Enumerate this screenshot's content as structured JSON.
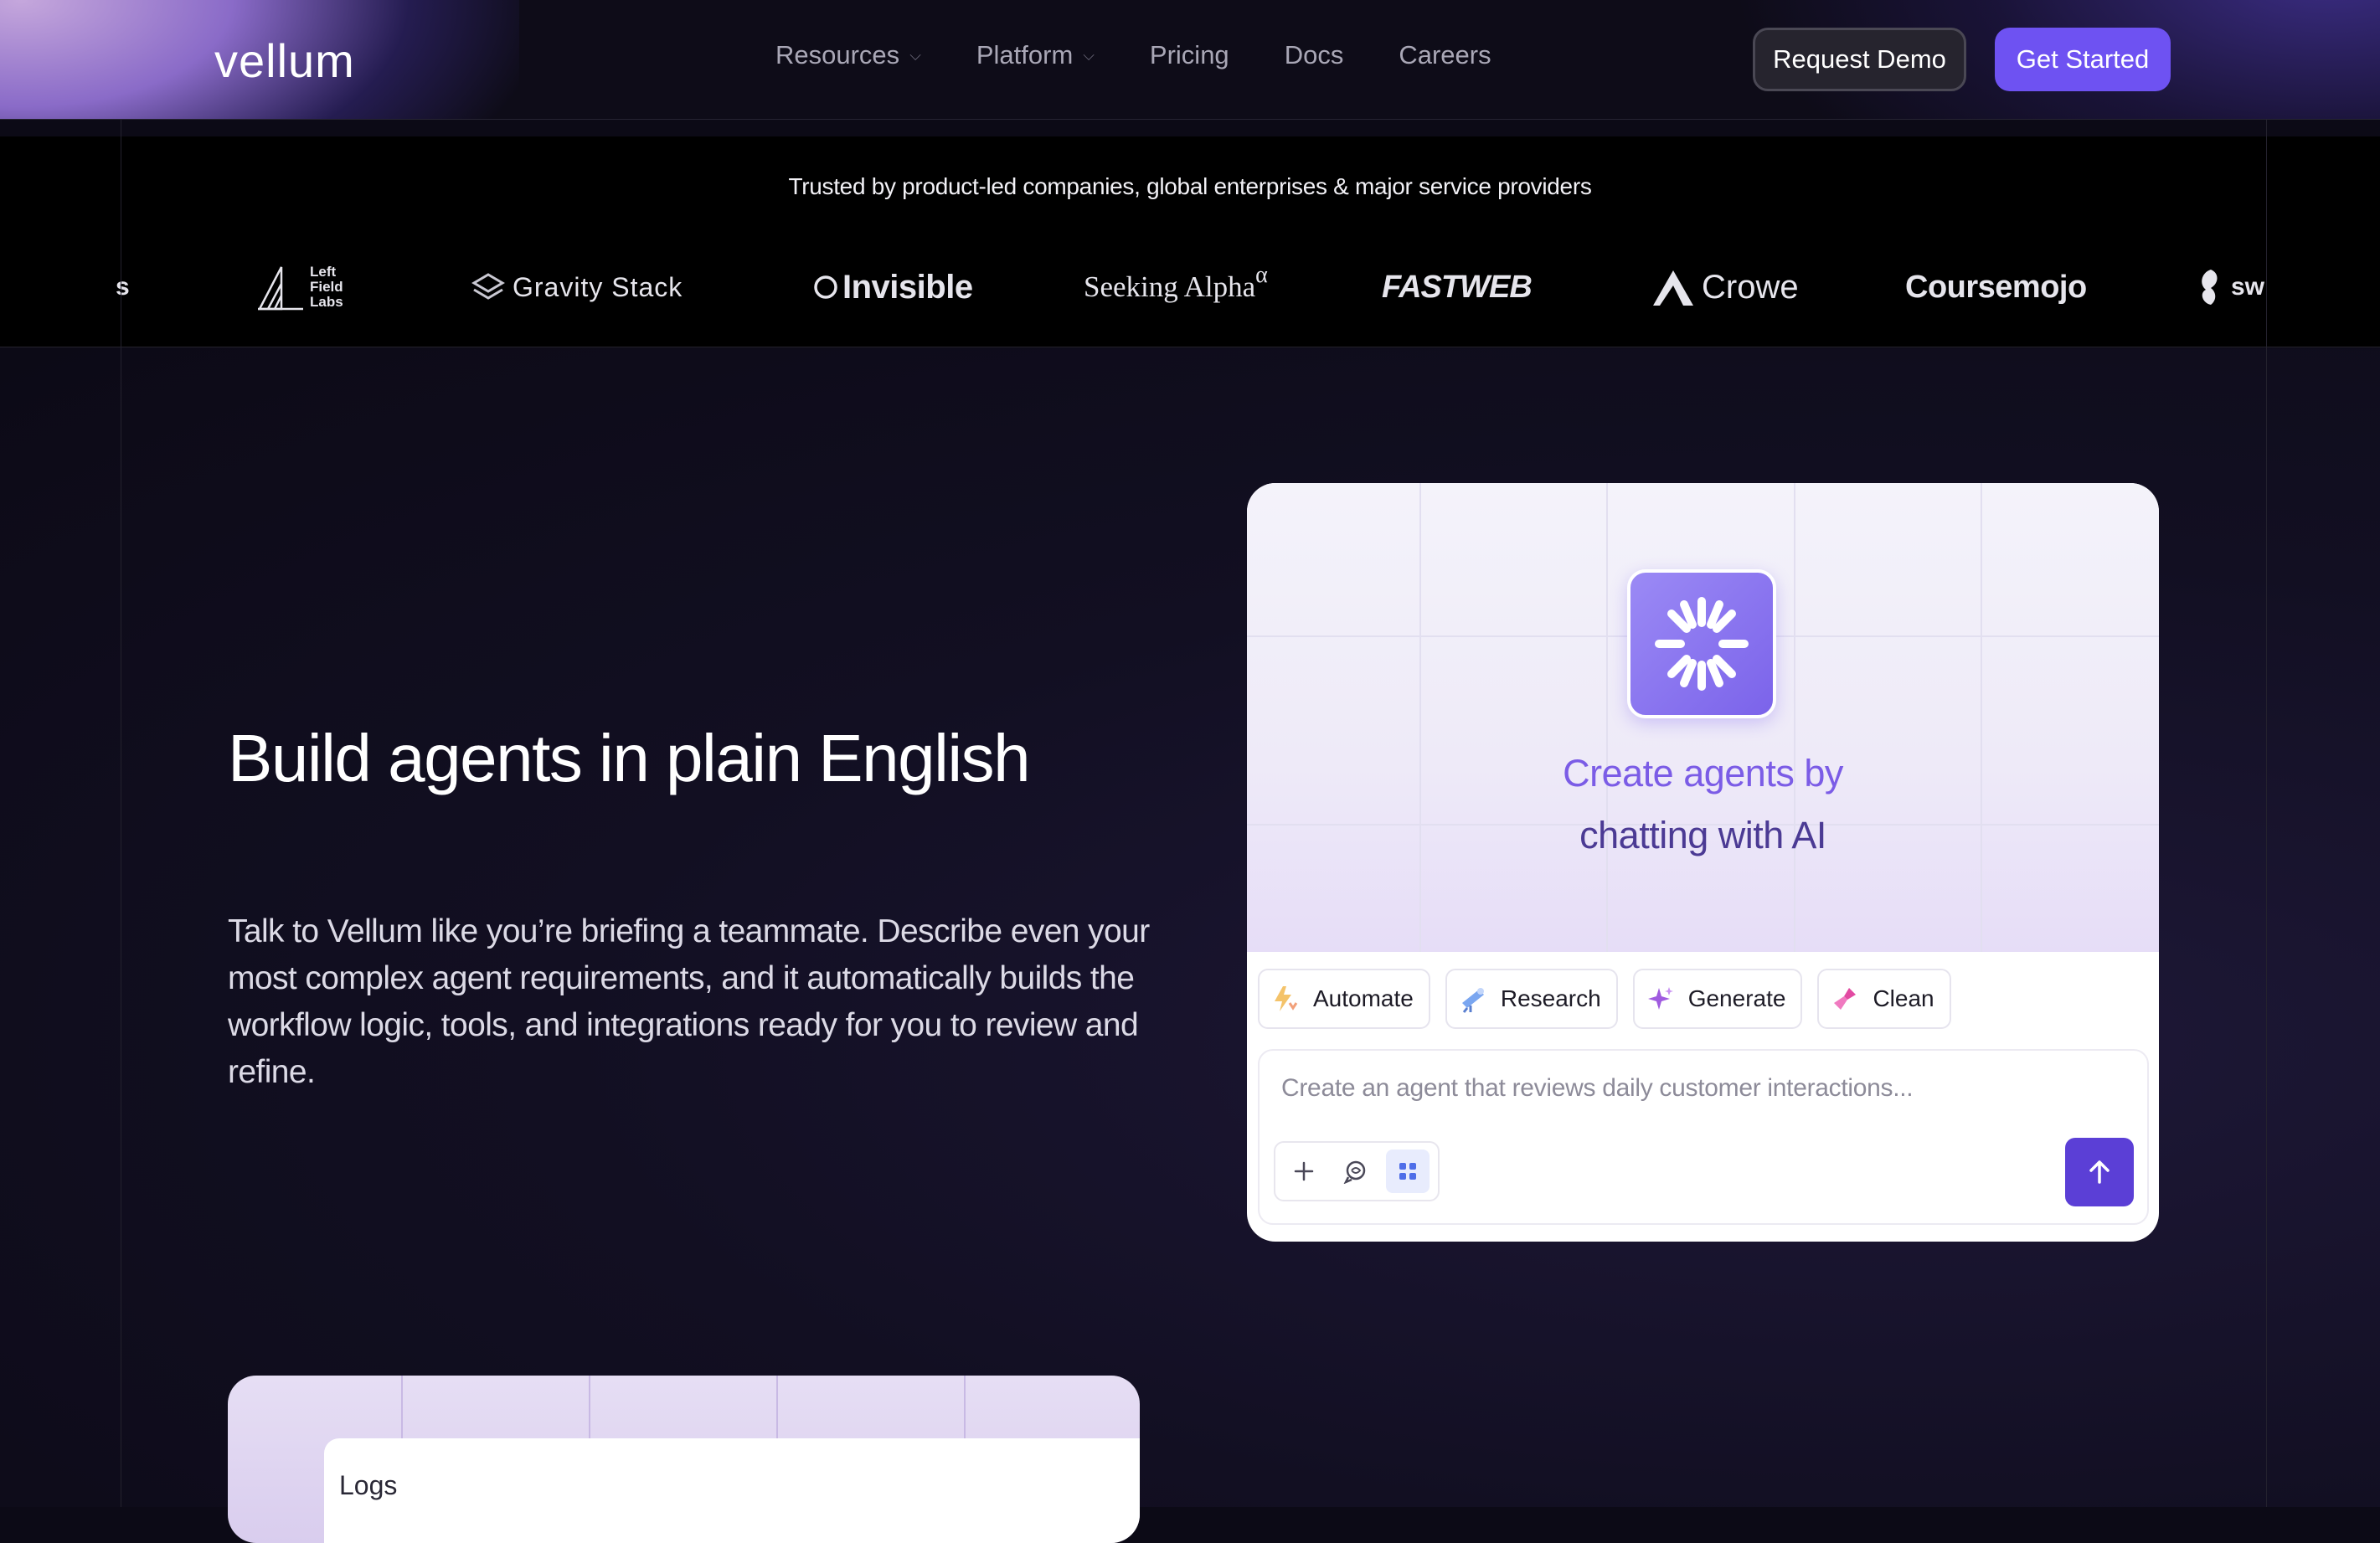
{
  "nav": {
    "logo": "vellum",
    "links": [
      {
        "label": "Resources",
        "dropdown": true
      },
      {
        "label": "Platform",
        "dropdown": true
      },
      {
        "label": "Pricing",
        "dropdown": false
      },
      {
        "label": "Docs",
        "dropdown": false
      },
      {
        "label": "Careers",
        "dropdown": false
      }
    ],
    "request_demo": "Request Demo",
    "get_started": "Get Started"
  },
  "trust": {
    "text": "Trusted by product-led companies, global enterprises & major service providers",
    "logos": {
      "partial_left": "s",
      "left_field_labs": [
        "Left",
        "Field",
        "Labs"
      ],
      "gravity_stack": "Gravity Stack",
      "invisible": "Invisible",
      "seeking_alpha": "Seeking Alpha",
      "seeking_alpha_mark": "α",
      "fastweb": "FASTWEB",
      "crowe": "Crowe",
      "coursemojo": "Coursemojo",
      "partial_right": "sw"
    }
  },
  "hero": {
    "headline": "Build agents in plain English",
    "description": "Talk to Vellum like you’re briefing a teammate. Describe even your most complex agent requirements, and it automatically builds the workflow logic, tools, and integrations ready for you to review and refine."
  },
  "card": {
    "title_line1": "Create agents by",
    "title_line2": "chatting with AI",
    "chips": [
      "Automate",
      "Research",
      "Generate",
      "Clean"
    ],
    "input_placeholder": "Create an agent that reviews daily customer interactions..."
  },
  "lower_card": {
    "label": "Logs"
  },
  "colors": {
    "accent": "#6e52f2",
    "send_button": "#5b3fd6",
    "title_light": "#7b5ce6",
    "title_dark": "#4b3a94"
  },
  "icons": [
    "chevron-down-icon",
    "sparkle-icon",
    "automate-icon",
    "research-icon",
    "generate-icon",
    "clean-icon",
    "plus-icon",
    "voice-icon",
    "grid-icon",
    "arrow-up-icon"
  ]
}
